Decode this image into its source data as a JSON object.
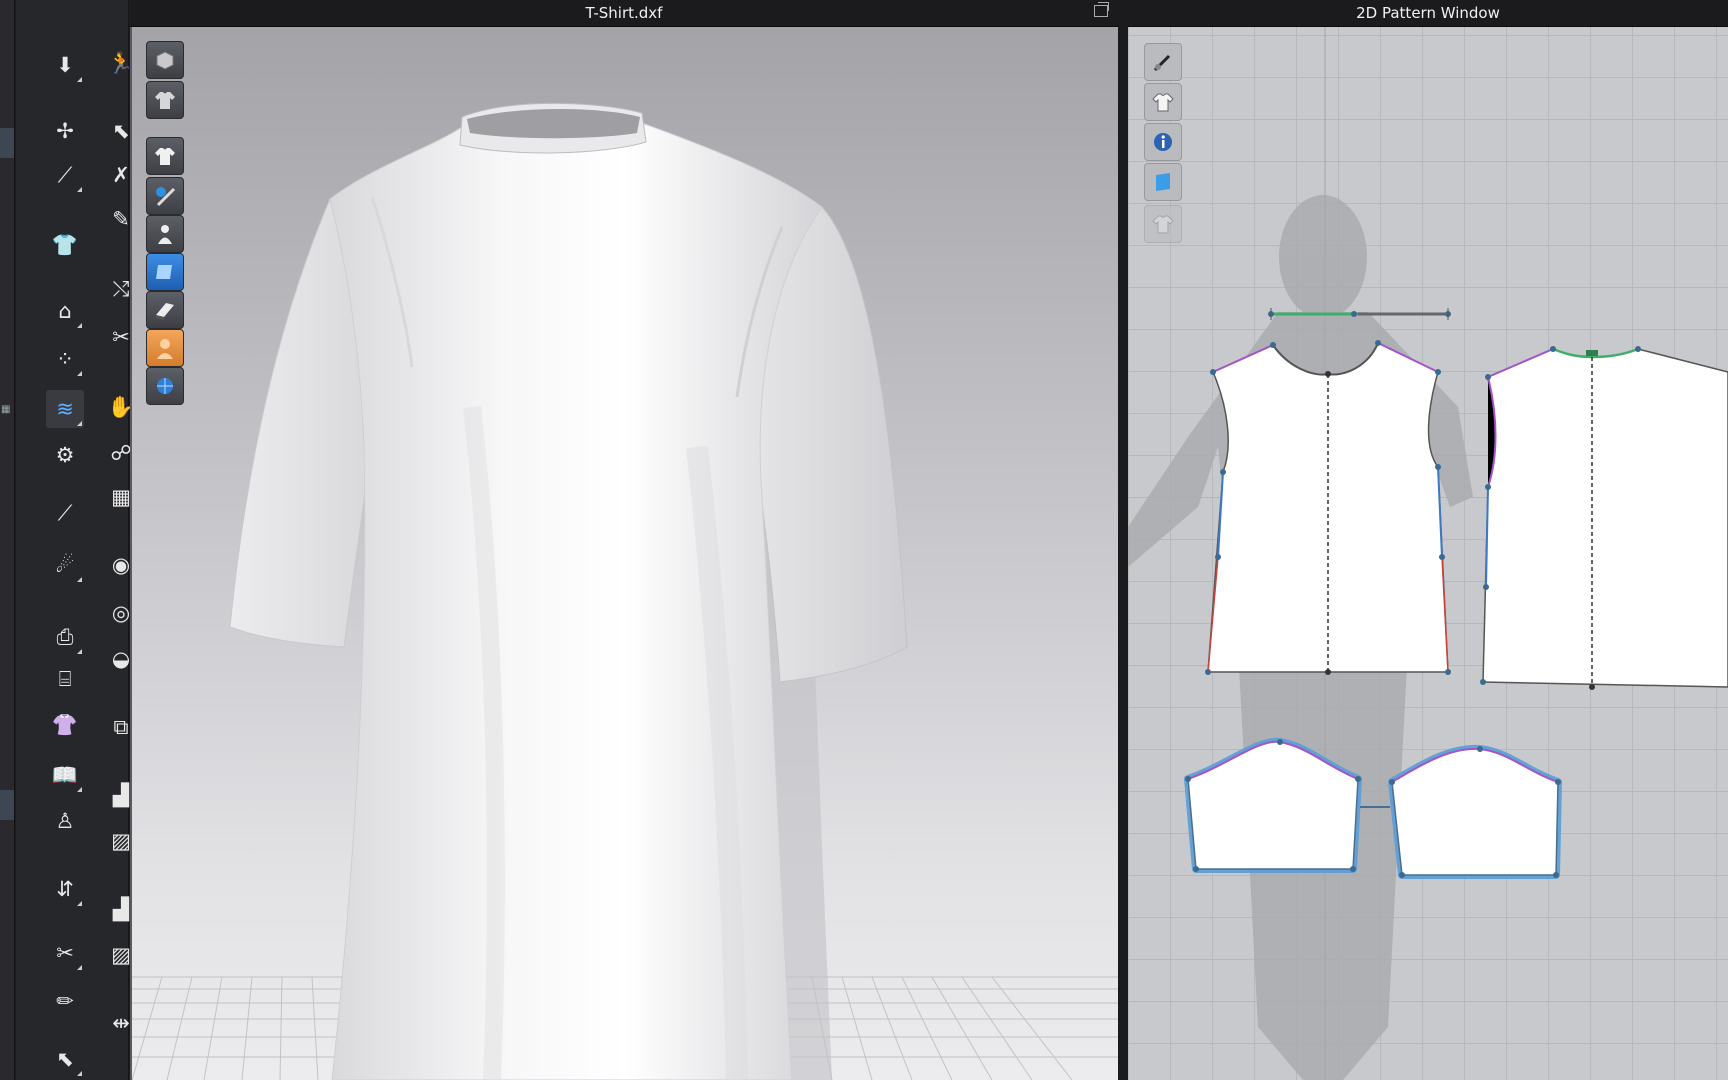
{
  "window": {
    "title_3d": "T-Shirt.dxf",
    "title_2d": "2D Pattern Window"
  },
  "toolbar": {
    "tools": [
      "pin-tool-icon",
      "avatar-motion-icon",
      "gizmo-move-icon",
      "select-mesh-icon",
      "edit-pattern-icon",
      "fold-tool-icon",
      "garment-icon",
      "tack-icon",
      "flip-icon",
      "puckering-icon",
      "points-icon",
      "avatar-edit-icon",
      "fabric-wave-icon",
      "sculpt-icon",
      "sewing-machine-icon",
      "pose-icon",
      "needle-icon",
      "pattern-icon",
      "pin-pull-icon",
      "button-icon",
      "stamp-icon",
      "button-edit-icon",
      "bag-icon",
      "zipper-icon",
      "folded-shirt-icon",
      "zipper-slider-icon",
      "book-icon",
      "texture-patch-icon",
      "avatar-small-icon",
      "gradient-patch-icon",
      "measure-icon",
      "texture-patch-2-icon",
      "cut-icon",
      "gradient-patch-2-icon",
      "pencil-icon",
      "symmetric-icon",
      "tool-more-icon"
    ]
  },
  "viewport_3d": {
    "tools": [
      "view-3d-box-icon",
      "view-garment-icon",
      "show-garment-icon",
      "texture-view-icon",
      "avatar-view-icon",
      "fabric-select-icon",
      "thickness-icon",
      "skin-view-icon",
      "globe-render-icon"
    ]
  },
  "pattern_window": {
    "tools": [
      "edit-texture-icon",
      "show-garment-2d-icon",
      "info-icon",
      "fabric-2d-icon",
      "lock-garment-icon"
    ]
  },
  "colors": {
    "seam_green": "#3fae6a",
    "seam_purple": "#a455c9",
    "seam_blue": "#3d79c2",
    "seam_red": "#c8443c",
    "selected_outline": "#5f9fd6"
  }
}
